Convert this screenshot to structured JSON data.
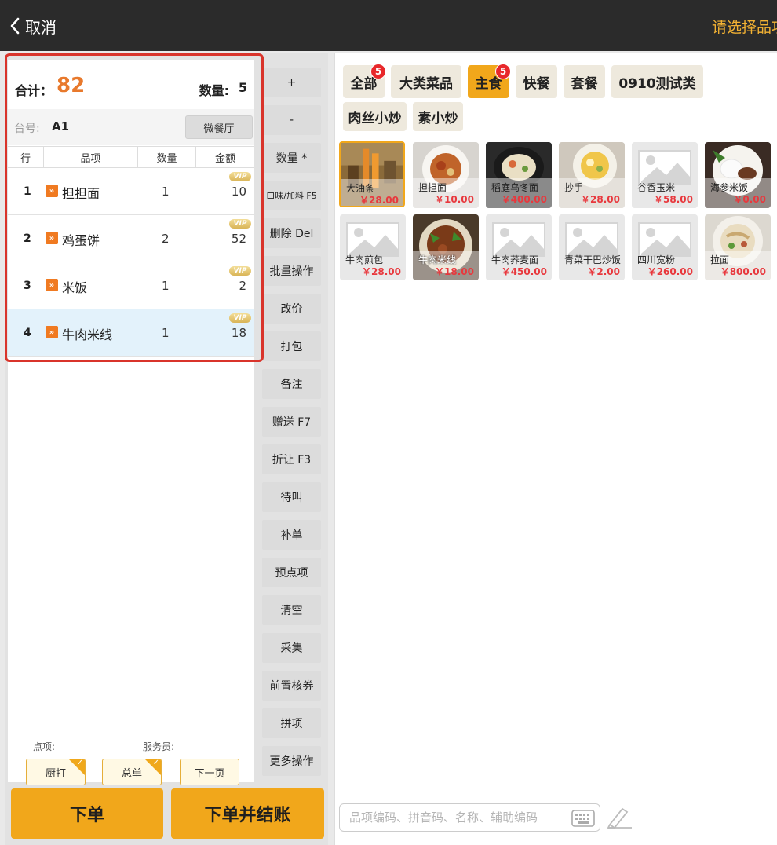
{
  "topbar": {
    "back_label": "取消",
    "hint": "请选择品项"
  },
  "order": {
    "total_label": "合计：",
    "total_value": "82",
    "qty_label": "数量:",
    "qty_value": "5",
    "table_label": "台号:",
    "table_value": "A1",
    "dining_button": "微餐厅",
    "columns": [
      "行",
      "品项",
      "数量",
      "金额"
    ],
    "vip_label": "VIP",
    "items": [
      {
        "idx": "1",
        "name": "担担面",
        "qty": "1",
        "amount": "10"
      },
      {
        "idx": "2",
        "name": "鸡蛋饼",
        "qty": "2",
        "amount": "52"
      },
      {
        "idx": "3",
        "name": "米饭",
        "qty": "1",
        "amount": "2"
      },
      {
        "idx": "4",
        "name": "牛肉米线",
        "qty": "1",
        "amount": "18"
      }
    ],
    "point_label": "点项:",
    "waiter_label": "服务员:",
    "kitchen_btn": "厨打",
    "total_btn": "总单",
    "next_btn": "下一页",
    "order_btn": "下单",
    "order_pay_btn": "下单并结账"
  },
  "actions": [
    "+",
    "-",
    "数量 *",
    "口味/加料 F5",
    "删除 Del",
    "批量操作",
    "改价",
    "打包",
    "备注",
    "赠送 F7",
    "折让 F3",
    "待叫",
    "补单",
    "预点项",
    "清空",
    "采集",
    "前置核券",
    "拼项",
    "更多操作"
  ],
  "categories": [
    {
      "label": "全部",
      "badge": "5"
    },
    {
      "label": "大类菜品"
    },
    {
      "label": "主食",
      "badge": "5",
      "active": true
    },
    {
      "label": "快餐"
    },
    {
      "label": "套餐"
    },
    {
      "label": "0910测试类"
    },
    {
      "label": "肉丝小炒"
    },
    {
      "label": "素小炒"
    }
  ],
  "menu_items": [
    {
      "name": "大油条",
      "price": "￥28.00"
    },
    {
      "name": "担担面",
      "price": "￥10.00"
    },
    {
      "name": "稻庭乌冬面",
      "price": "￥400.00"
    },
    {
      "name": "抄手",
      "price": "￥28.00"
    },
    {
      "name": "谷香玉米",
      "price": "￥58.00"
    },
    {
      "name": "海参米饭",
      "price": "￥0.00"
    },
    {
      "name": "牛肉煎包",
      "price": "￥28.00"
    },
    {
      "name": "牛肉米线",
      "price": "￥18.00"
    },
    {
      "name": "牛肉荞麦面",
      "price": "￥450.00"
    },
    {
      "name": "青菜干巴炒饭",
      "price": "￥2.00"
    },
    {
      "name": "四川宽粉",
      "price": "￥260.00"
    },
    {
      "name": "拉面",
      "price": "￥800.00"
    }
  ],
  "search": {
    "placeholder": "品项编码、拼音码、名称、辅助编码"
  },
  "colors": {
    "accent": "#f1a71b",
    "total": "#e8792c",
    "price": "#e8383d",
    "badge": "#e8282b",
    "highlight": "#d9342b"
  }
}
